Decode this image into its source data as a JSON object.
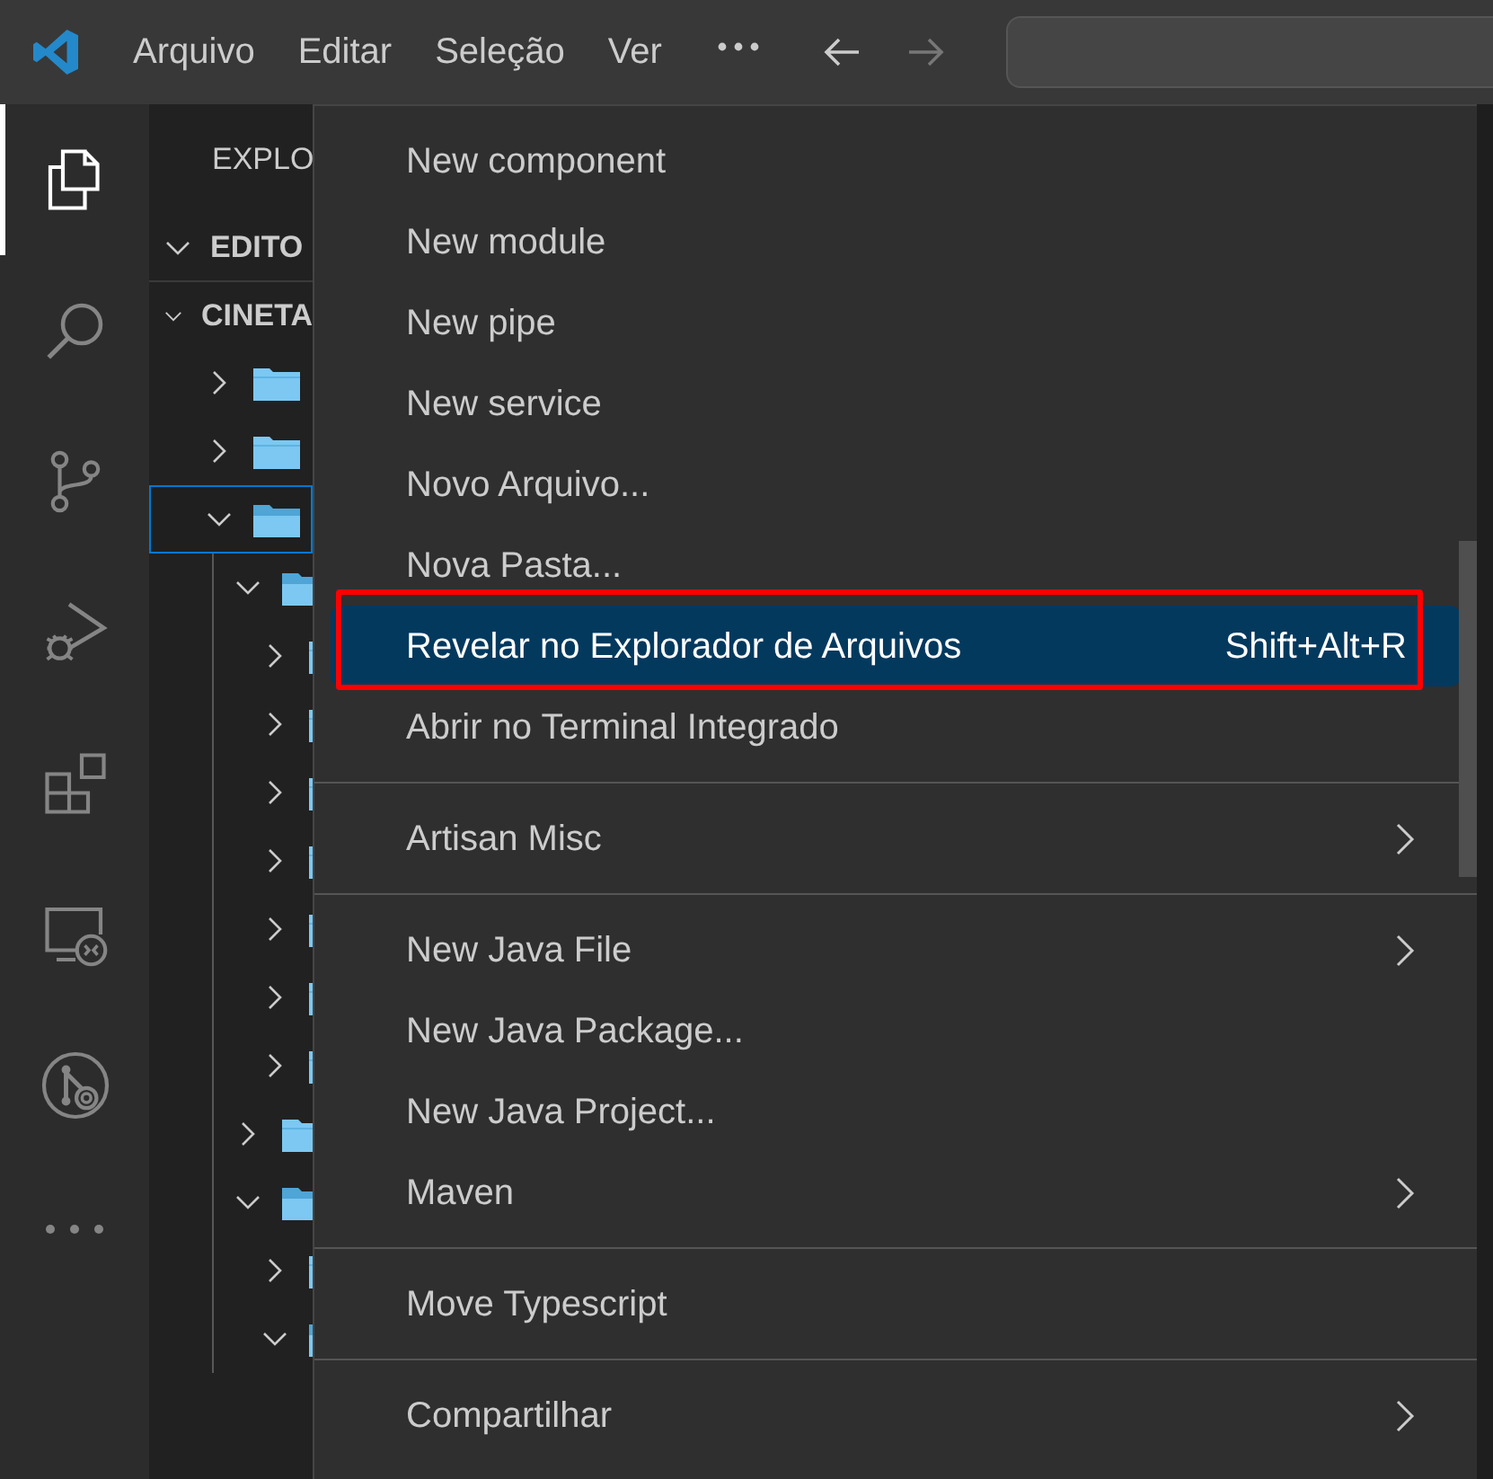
{
  "title_bar": {
    "menus": [
      "Arquivo",
      "Editar",
      "Seleção",
      "Ver"
    ],
    "back": {
      "disabled": false
    },
    "forward": {
      "disabled": true
    }
  },
  "activity_bar": [
    {
      "kind": "explorer",
      "selected": true
    },
    {
      "kind": "search",
      "selected": false
    },
    {
      "kind": "source-control",
      "selected": false
    },
    {
      "kind": "run",
      "selected": false
    },
    {
      "kind": "extensions",
      "selected": false
    },
    {
      "kind": "remote",
      "selected": false
    },
    {
      "kind": "graph",
      "selected": false
    },
    {
      "kind": "more",
      "selected": false
    }
  ],
  "sidebar": {
    "title": "EXPLO",
    "sections": [
      {
        "label": "EDITO",
        "expanded": true
      },
      {
        "label": "CINETA",
        "expanded": true,
        "children": [
          {
            "expanded": false,
            "selected": false
          },
          {
            "expanded": false,
            "selected": false
          },
          {
            "expanded": true,
            "selected": true,
            "children": [
              {
                "expanded": true,
                "selected": false,
                "children": [
                  {
                    "expanded": false,
                    "selected": false
                  },
                  {
                    "expanded": false,
                    "selected": false
                  },
                  {
                    "expanded": false,
                    "selected": false
                  },
                  {
                    "expanded": false,
                    "selected": false
                  },
                  {
                    "expanded": false,
                    "selected": false
                  },
                  {
                    "expanded": false,
                    "selected": false
                  },
                  {
                    "expanded": false,
                    "selected": false
                  }
                ]
              },
              {
                "expanded": false,
                "selected": false
              },
              {
                "expanded": true,
                "selected": false,
                "children": [
                  {
                    "expanded": false,
                    "selected": false
                  },
                  {
                    "expanded": true,
                    "selected": false
                  }
                ]
              }
            ]
          }
        ]
      }
    ]
  },
  "context_menu": {
    "groups": [
      [
        {
          "label": "New component",
          "selected": false
        },
        {
          "label": "New module",
          "selected": false
        },
        {
          "label": "New pipe",
          "selected": false
        },
        {
          "label": "New service",
          "selected": false
        },
        {
          "label": "Novo Arquivo...",
          "selected": false
        },
        {
          "label": "Nova Pasta...",
          "selected": false
        },
        {
          "label": "Revelar no Explorador de Arquivos",
          "shortcut": "Shift+Alt+R",
          "selected": true,
          "annotated": true
        },
        {
          "label": "Abrir no Terminal Integrado",
          "selected": false
        }
      ],
      [
        {
          "label": "Artisan Misc",
          "submenu": true,
          "selected": false
        }
      ],
      [
        {
          "label": "New Java File",
          "submenu": true,
          "selected": false
        },
        {
          "label": "New Java Package...",
          "selected": false
        },
        {
          "label": "New Java Project...",
          "selected": false
        },
        {
          "label": "Maven",
          "submenu": true,
          "selected": false
        }
      ],
      [
        {
          "label": "Move Typescript",
          "selected": false
        }
      ],
      [
        {
          "label": "Compartilhar",
          "submenu": true,
          "selected": false
        }
      ]
    ]
  }
}
